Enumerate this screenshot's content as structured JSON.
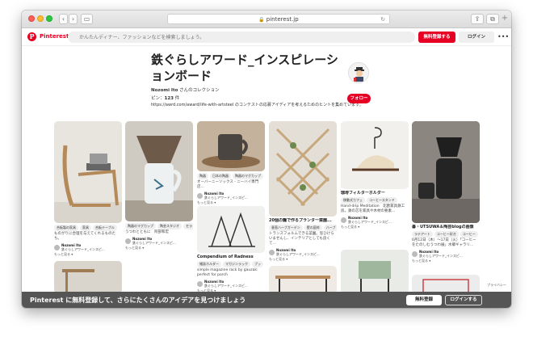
{
  "browser": {
    "url": "pinterest.jp"
  },
  "header": {
    "logo": "P",
    "brand": "Pinterest",
    "search_placeholder": "かんたんディナー、ファッションなどを検索しましょう。",
    "signup_label": "無料登録する",
    "login_label": "ログイン",
    "more_label": "•••"
  },
  "board": {
    "title": "鉄ぐらしアワード_インスピレーションボード",
    "owner_name": "Nozomi Ito",
    "owner_suffix": " さんのコレクション",
    "pins_label": "ピン：",
    "pins_count": "123",
    "pins_unit": " 件",
    "description": "https://awrd.com/award/life-with-artsteel のコンテストの応募アイディアを考えるためのヒントを集めています。",
    "follow_label": "フォロー"
  },
  "pins": [
    {
      "title": "",
      "desc": "ものがりに合理を与えてくれるものたち。",
      "chips": [
        "合板製の家具",
        "家具",
        "合板テーブル"
      ],
      "saver": "Nozomi Ito",
      "board": "鉄ぐらしアワード_インスピ...",
      "more": "もっと見る ▾"
    },
    {
      "title": "",
      "desc": "うつわとともに　阿部和宏",
      "chips": [
        "陶器のマグカップ",
        "陶芸スタジオ",
        "セラ"
      ],
      "saver": "Nozomi Ito",
      "board": "鉄ぐらしアワード_インスピ...",
      "more": "もっと見る ▾"
    },
    {
      "title": "",
      "desc": "オーバーニーソックス - ニーハイ専門店...",
      "chips": [
        "陶器",
        "日本の陶器",
        "陶器のマグカップ"
      ],
      "saver": "Nozomi Ito",
      "board": "鉄ぐらしアワード_インスピ...",
      "more": "もっと見る ▾"
    },
    {
      "title": "Compendium of Radness",
      "desc": "simple magazine rack by gauzak: perfect for porch",
      "chips": [
        "雑誌ホルダー",
        "マガジンラック",
        "ブッ"
      ],
      "saver": "Nozomi Ito",
      "board": "鉄ぐらしアワード_インスピ...",
      "more": "もっと見る ▾"
    },
    {
      "title": "20個の籠で作るプランター菜園...",
      "desc": "トランスフォルムできる菜園。窓ひけらいませんし、インテリアとしても良くて...",
      "chips": [
        "垂直ハーブガーデン",
        "壁の庭枠",
        "ハーブ"
      ],
      "saver": "Nozomi Ito",
      "board": "鉄ぐらしアワード_インスピ...",
      "more": "もっと見る ▾"
    },
    {
      "title": "珈琲フィルターホルダー",
      "desc": "Hand-drip Meditation　北欧家具鉄工房。鉄の芯を家具や木材の要素...",
      "chips": [
        "移動式カフェ",
        "コーヒースタンド"
      ],
      "saver": "Nozomi Ito",
      "board": "鉄ぐらしアワード_インスピ...",
      "more": "もっと見る ▾"
    },
    {
      "title": "暮・UTSUWA＆陶芸blogの画像",
      "desc": "",
      "chips": [
        "ラテアート",
        "コーヒー好き",
        "コーヒー"
      ],
      "saver": "Nozomi Ito",
      "board": "鉄ぐらしアワード_インスピ...",
      "more": "もっと見る ▾",
      "extra": "6月12日（木）〜17日（火）「コーヒーをたのしむうつわ展」水郷ギャラリ..."
    }
  ],
  "banner": {
    "text": "Pinterest に無料登録して、さらにたくさんのアイデアを見つけましょう",
    "signup_label": "無料登録",
    "login_label": "ログインする"
  },
  "privacy_label": "プライバシー",
  "colors": {
    "brand_red": "#e60023",
    "banner_bg": "#555555"
  }
}
